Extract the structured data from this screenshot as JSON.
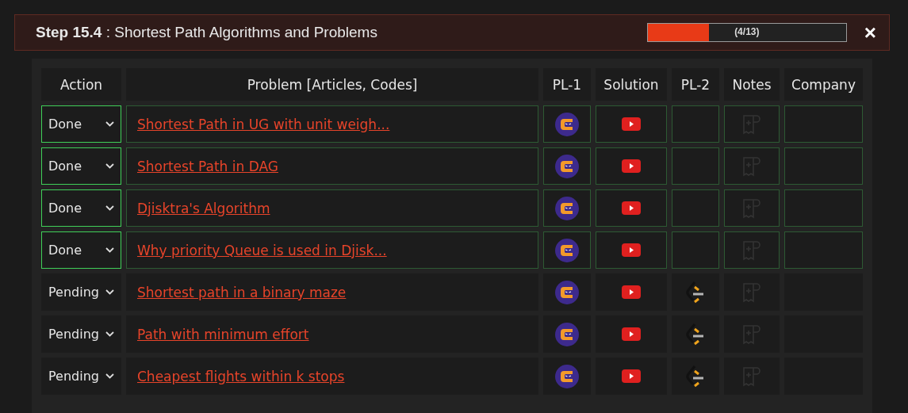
{
  "step": {
    "number": "Step 15.4",
    "separator": ":",
    "title": "Shortest Path Algorithms and Problems"
  },
  "progress": {
    "level": 0.3077,
    "label": "(4/13)"
  },
  "close": "×",
  "columns": [
    "Action",
    "Problem [Articles, Codes]",
    "PL-1",
    "Solution",
    "PL-2",
    "Notes",
    "Company"
  ],
  "rows": [
    {
      "status": "Done",
      "done": true,
      "problem": "Shortest Path in UG with unit weigh...",
      "pl1": true,
      "solution": true,
      "pl2": false
    },
    {
      "status": "Done",
      "done": true,
      "problem": "Shortest Path in DAG",
      "pl1": true,
      "solution": true,
      "pl2": false
    },
    {
      "status": "Done",
      "done": true,
      "problem": "Djisktra's Algorithm",
      "pl1": true,
      "solution": true,
      "pl2": false
    },
    {
      "status": "Done",
      "done": true,
      "problem": "Why priority Queue is used in Djisk...",
      "pl1": true,
      "solution": true,
      "pl2": false
    },
    {
      "status": "Pending",
      "done": false,
      "problem": "Shortest path in a binary maze",
      "pl1": true,
      "solution": true,
      "pl2": true
    },
    {
      "status": "Pending",
      "done": false,
      "problem": "Path with minimum effort",
      "pl1": true,
      "solution": true,
      "pl2": true
    },
    {
      "status": "Pending",
      "done": false,
      "problem": "Cheapest flights within k stops",
      "pl1": true,
      "solution": true,
      "pl2": true
    }
  ]
}
